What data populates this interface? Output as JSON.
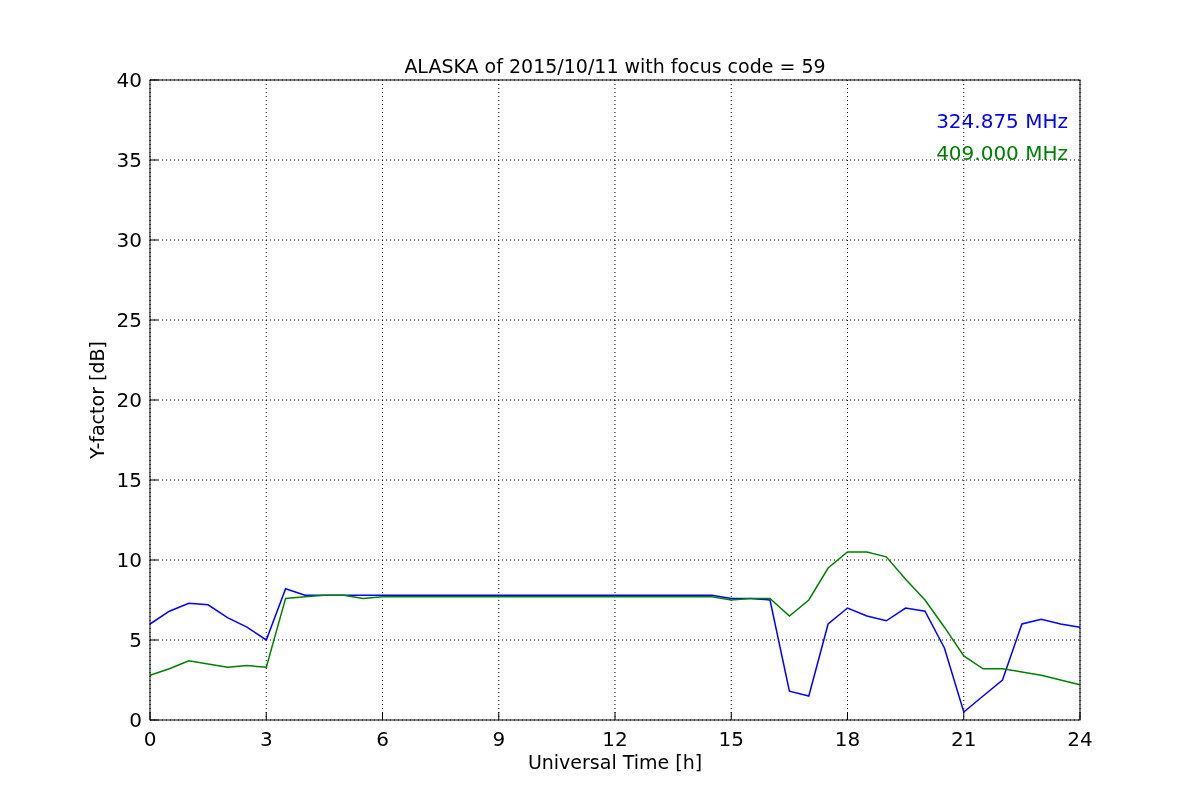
{
  "figure": {
    "chart_data": {
      "type": "line",
      "title": "ALASKA of 2015/10/11 with focus code = 59",
      "xlabel": "Universal Time [h]",
      "ylabel": "Y-factor [dB]",
      "x": [
        0,
        0.5,
        1,
        1.5,
        2,
        2.5,
        3,
        3.5,
        4,
        4.5,
        5,
        5.5,
        6,
        6.5,
        7,
        7.5,
        8,
        8.5,
        9,
        9.5,
        10,
        10.5,
        11,
        11.5,
        12,
        12.5,
        13,
        13.5,
        14,
        14.5,
        15,
        15.5,
        16,
        16.5,
        17,
        17.5,
        18,
        18.5,
        19,
        19.5,
        20,
        20.5,
        21,
        21.5,
        22,
        22.5,
        23,
        23.5,
        24
      ],
      "series": [
        {
          "name": "324.875 MHz",
          "color": "#0000ff",
          "values": [
            6.0,
            6.8,
            7.3,
            7.2,
            6.4,
            5.8,
            5.0,
            8.2,
            7.8,
            7.8,
            7.8,
            7.8,
            7.8,
            7.8,
            7.8,
            7.8,
            7.8,
            7.8,
            7.8,
            7.8,
            7.8,
            7.8,
            7.8,
            7.8,
            7.8,
            7.8,
            7.8,
            7.8,
            7.8,
            7.8,
            7.6,
            7.6,
            7.5,
            1.8,
            1.5,
            6.0,
            7.0,
            6.5,
            6.2,
            7.0,
            6.8,
            4.5,
            0.5,
            1.5,
            2.5,
            6.0,
            6.3,
            6.0,
            5.8
          ]
        },
        {
          "name": "409.000 MHz",
          "color": "#008000",
          "values": [
            2.8,
            3.2,
            3.7,
            3.5,
            3.3,
            3.4,
            3.3,
            7.6,
            7.7,
            7.8,
            7.8,
            7.6,
            7.7,
            7.7,
            7.7,
            7.7,
            7.7,
            7.7,
            7.7,
            7.7,
            7.7,
            7.7,
            7.7,
            7.7,
            7.7,
            7.7,
            7.7,
            7.7,
            7.7,
            7.7,
            7.5,
            7.6,
            7.6,
            6.5,
            7.5,
            9.5,
            10.5,
            10.5,
            10.2,
            8.8,
            7.5,
            5.8,
            4.0,
            3.2,
            3.2,
            3.0,
            2.8,
            2.5,
            2.2
          ]
        }
      ],
      "xlim": [
        0,
        24
      ],
      "ylim": [
        0,
        40
      ],
      "xticks": [
        0,
        3,
        6,
        9,
        12,
        15,
        18,
        21,
        24
      ],
      "yticks": [
        0,
        5,
        10,
        15,
        20,
        25,
        30,
        35,
        40
      ],
      "grid": true
    }
  }
}
